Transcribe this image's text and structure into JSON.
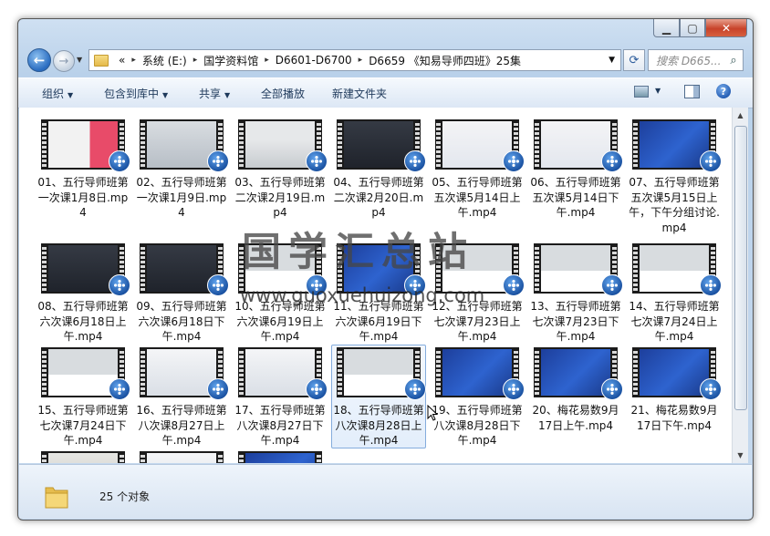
{
  "window": {
    "address": {
      "prefix": "«",
      "crumbs": [
        "系统 (E:)",
        "国学资料馆",
        "D6601-D6700",
        "D6659 《知易导师四班》25集"
      ]
    },
    "search_placeholder": "搜索 D665...",
    "toolbar": {
      "organize": "组织",
      "include": "包含到库中",
      "share": "共享",
      "play_all": "全部播放",
      "new_folder": "新建文件夹"
    }
  },
  "files": [
    {
      "name": "01、五行导师班第一次课1月8日.mp4",
      "thumb": "red"
    },
    {
      "name": "02、五行导师班第一次课1月9日.mp4",
      "thumb": "screen"
    },
    {
      "name": "03、五行导师班第二次课2月19日.mp4",
      "thumb": "room"
    },
    {
      "name": "04、五行导师班第二次课2月20日.mp4",
      "thumb": "dark"
    },
    {
      "name": "05、五行导师班第五次课5月14日上午.mp4",
      "thumb": "icons"
    },
    {
      "name": "06、五行导师班第五次课5月14日下午.mp4",
      "thumb": "icons"
    },
    {
      "name": "07、五行导师班第五次课5月15日上午，下午分组讨论.mp4",
      "thumb": "blue"
    },
    {
      "name": "08、五行导师班第六次课6月18日上午.mp4",
      "thumb": "dark"
    },
    {
      "name": "09、五行导师班第六次课6月18日下午.mp4",
      "thumb": "dark"
    },
    {
      "name": "10、五行导师班第六次课6月19日上午.mp4",
      "thumb": "person"
    },
    {
      "name": "11、五行导师班第六次课6月19日下午.mp4",
      "thumb": "blue"
    },
    {
      "name": "12、五行导师班第七次课7月23日上午.mp4",
      "thumb": "person"
    },
    {
      "name": "13、五行导师班第七次课7月23日下午.mp4",
      "thumb": "person"
    },
    {
      "name": "14、五行导师班第七次课7月24日上午.mp4",
      "thumb": "person"
    },
    {
      "name": "15、五行导师班第七次课7月24日下午.mp4",
      "thumb": "person"
    },
    {
      "name": "16、五行导师班第八次课8月27日上午.mp4",
      "thumb": "white"
    },
    {
      "name": "17、五行导师班第八次课8月27日下午.mp4",
      "thumb": "white"
    },
    {
      "name": "18、五行导师班第八次课8月28日上午.mp4",
      "thumb": "person",
      "selected": true
    },
    {
      "name": "19、五行导师班第八次课8月28日下午.mp4",
      "thumb": "blue"
    },
    {
      "name": "20、梅花易数9月17日上午.mp4",
      "thumb": "blue"
    },
    {
      "name": "21、梅花易数9月17日下午.mp4",
      "thumb": "blue"
    },
    {
      "name": "",
      "thumb": "people"
    },
    {
      "name": "",
      "thumb": "white"
    },
    {
      "name": "",
      "thumb": "blue"
    }
  ],
  "status": {
    "count": "25 个对象"
  },
  "watermark": {
    "title": "国学汇总站",
    "url": "www.guoxuehuizong.com"
  },
  "colors": {
    "accent": "#1f58b0",
    "selection": "#e3eefb",
    "chrome": "#c6d9ee"
  }
}
